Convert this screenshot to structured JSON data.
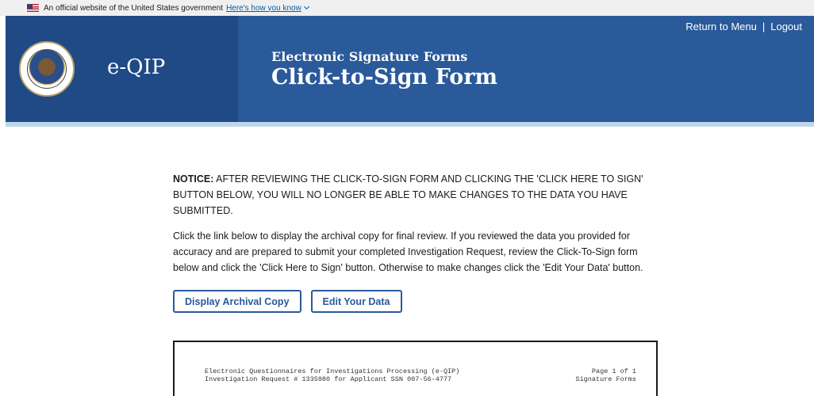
{
  "gov_banner": {
    "text": "An official website of the United States government",
    "link": "Here's how you know"
  },
  "header": {
    "brand": "e-QIP",
    "subtitle": "Electronic Signature Forms",
    "title": "Click-to-Sign Form",
    "nav": {
      "return_label": "Return to Menu",
      "separator": "|",
      "logout_label": "Logout"
    }
  },
  "content": {
    "notice_label": "NOTICE:",
    "notice_text": " AFTER REVIEWING THE CLICK-TO-SIGN FORM AND CLICKING THE 'CLICK HERE TO SIGN' BUTTON BELOW, YOU WILL NO LONGER BE ABLE TO MAKE CHANGES TO THE DATA YOU HAVE SUBMITTED.",
    "instructions": "Click the link below to display the archival copy for final review. If you reviewed the data you provided for accuracy and are prepared to submit your completed Investigation Request, review the Click-To-Sign form below and click the 'Click Here to Sign' button. Otherwise to make changes click the 'Edit Your Data' button.",
    "buttons": {
      "display_archival": "Display Archival Copy",
      "edit_data": "Edit Your Data"
    }
  },
  "form_preview": {
    "line1_left": "Electronic Questionnaires for Investigations Processing (e-QIP)",
    "line2_left": "Investigation Request # 1335980 for Applicant SSN 007-56-4777",
    "line1_right": "Page 1 of 1",
    "line2_right": "Signature Forms"
  },
  "colors": {
    "header_blue": "#2a5a9a",
    "header_dark_blue": "#1f4a85",
    "link_blue": "#005ea2"
  }
}
